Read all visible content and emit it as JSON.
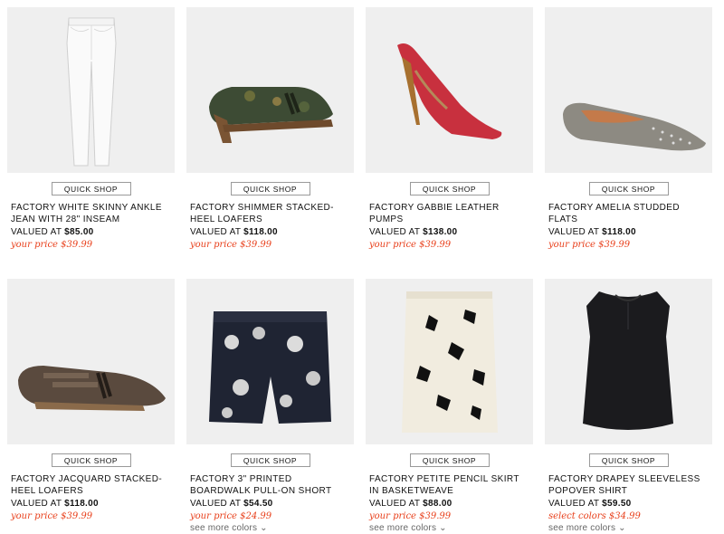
{
  "colors": {
    "price_accent": "#e8401c",
    "image_bg": "#efefef"
  },
  "products": [
    {
      "image": "white-jeans-image",
      "quick_shop": "QUICK SHOP",
      "title_l1": "FACTORY WHITE SKINNY ANKLE",
      "title_l2": "JEAN WITH 28\" INSEAM",
      "valued_prefix": "VALUED AT",
      "valued_price": "$85.00",
      "your_price": "your price $39.99",
      "see_more": ""
    },
    {
      "image": "tapestry-loafer-image",
      "quick_shop": "QUICK SHOP",
      "title_l1": "FACTORY SHIMMER STACKED-",
      "title_l2": "HEEL LOAFERS",
      "valued_prefix": "VALUED AT",
      "valued_price": "$118.00",
      "your_price": "your price $39.99",
      "see_more": ""
    },
    {
      "image": "red-pump-image",
      "quick_shop": "QUICK SHOP",
      "title_l1": "FACTORY GABBIE LEATHER",
      "title_l2": "PUMPS",
      "valued_prefix": "VALUED AT",
      "valued_price": "$138.00",
      "your_price": "your price $39.99",
      "see_more": ""
    },
    {
      "image": "studded-flat-image",
      "quick_shop": "QUICK SHOP",
      "title_l1": "FACTORY AMELIA STUDDED",
      "title_l2": "FLATS",
      "valued_prefix": "VALUED AT",
      "valued_price": "$118.00",
      "your_price": "your price $39.99",
      "see_more": ""
    },
    {
      "image": "jacquard-loafer-image",
      "quick_shop": "QUICK SHOP",
      "title_l1": "FACTORY JACQUARD STACKED-",
      "title_l2": "HEEL LOAFERS",
      "valued_prefix": "VALUED AT",
      "valued_price": "$118.00",
      "your_price": "your price $39.99",
      "see_more": ""
    },
    {
      "image": "floral-shorts-image",
      "quick_shop": "QUICK SHOP",
      "title_l1": "FACTORY 3\" PRINTED",
      "title_l2": "BOARDWALK PULL-ON SHORT",
      "valued_prefix": "VALUED AT",
      "valued_price": "$54.50",
      "your_price": "your price $24.99",
      "see_more": "see more colors ⌄"
    },
    {
      "image": "floral-skirt-image",
      "quick_shop": "QUICK SHOP",
      "title_l1": "FACTORY PETITE PENCIL SKIRT",
      "title_l2": "IN BASKETWEAVE",
      "valued_prefix": "VALUED AT",
      "valued_price": "$88.00",
      "your_price": "your price $39.99",
      "see_more": "see more colors ⌄"
    },
    {
      "image": "black-top-image",
      "quick_shop": "QUICK SHOP",
      "title_l1": "FACTORY DRAPEY SLEEVELESS",
      "title_l2": "POPOVER SHIRT",
      "valued_prefix": "VALUED AT",
      "valued_price": "$59.50",
      "your_price": "select colors $34.99",
      "see_more": "see more colors ⌄"
    }
  ]
}
